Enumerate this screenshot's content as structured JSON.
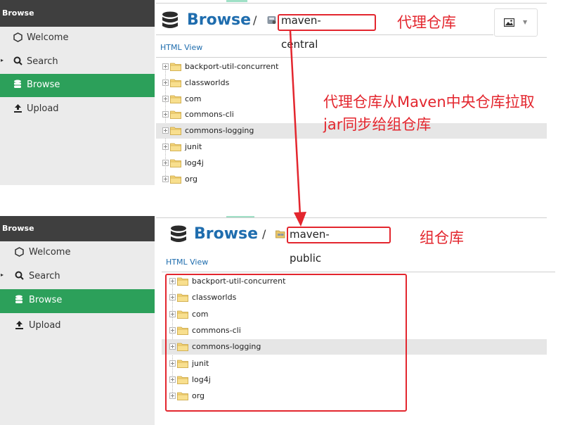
{
  "top": {
    "sidebar": {
      "header": "Browse",
      "items": [
        {
          "label": "Welcome",
          "icon": "hexagon-icon",
          "active": false
        },
        {
          "label": "Search",
          "icon": "search-icon",
          "active": false
        },
        {
          "label": "Browse",
          "icon": "database-icon",
          "active": true
        },
        {
          "label": "Upload",
          "icon": "upload-icon",
          "active": false
        }
      ]
    },
    "breadcrumb": {
      "title": "Browse",
      "separator": "/",
      "repository": "maven-central"
    },
    "html_view": "HTML View",
    "tree": [
      {
        "label": "backport-util-concurrent",
        "highlighted": false
      },
      {
        "label": "classworlds",
        "highlighted": false
      },
      {
        "label": "com",
        "highlighted": false
      },
      {
        "label": "commons-cli",
        "highlighted": false
      },
      {
        "label": "commons-logging",
        "highlighted": true
      },
      {
        "label": "junit",
        "highlighted": false
      },
      {
        "label": "log4j",
        "highlighted": false
      },
      {
        "label": "org",
        "highlighted": false
      }
    ]
  },
  "bottom": {
    "sidebar": {
      "header": "Browse",
      "items": [
        {
          "label": "Welcome",
          "icon": "hexagon-icon",
          "active": false
        },
        {
          "label": "Search",
          "icon": "search-icon",
          "active": false
        },
        {
          "label": "Browse",
          "icon": "database-icon",
          "active": true
        },
        {
          "label": "Upload",
          "icon": "upload-icon",
          "active": false
        }
      ]
    },
    "breadcrumb": {
      "title": "Browse",
      "separator": "/",
      "repository": "maven-public"
    },
    "html_view": "HTML View",
    "tree": [
      {
        "label": "backport-util-concurrent",
        "highlighted": false
      },
      {
        "label": "classworlds",
        "highlighted": false
      },
      {
        "label": "com",
        "highlighted": false
      },
      {
        "label": "commons-cli",
        "highlighted": false
      },
      {
        "label": "commons-logging",
        "highlighted": true
      },
      {
        "label": "junit",
        "highlighted": false
      },
      {
        "label": "log4j",
        "highlighted": false
      },
      {
        "label": "org",
        "highlighted": false
      }
    ]
  },
  "annotations": {
    "proxy_repo": "代理仓库",
    "pull_line1": "代理仓库从Maven中央仓库拉取",
    "pull_line2": "jar同步给组仓库",
    "group_repo": "组仓库"
  },
  "colors": {
    "accent_green": "#2ca05a",
    "title_blue": "#1f6dae",
    "annotation_red": "#e3262e",
    "sidebar_bg": "#ebebeb",
    "sidebar_header": "#3f3f3f"
  }
}
